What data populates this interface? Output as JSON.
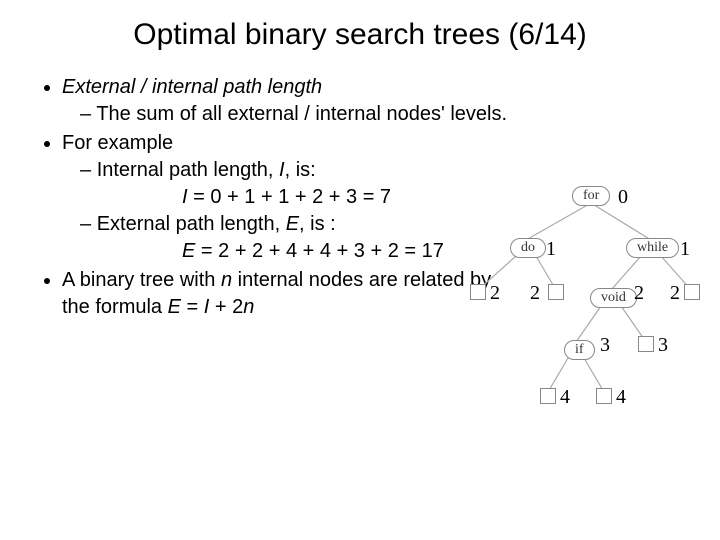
{
  "title": "Optimal binary search trees (6/14)",
  "bullets": {
    "b1": "External / internal path length",
    "b1s1": "The sum of all external / internal nodes' levels.",
    "b2": "For example",
    "b2s1_a": "Internal path length, ",
    "b2s1_var": "I",
    "b2s1_b": ", is:",
    "b2f1_a": "I",
    "b2f1_b": " = 0 + 1 + 1 + 2 + 3 = 7",
    "b2s2_a": "External path length, ",
    "b2s2_var": "E",
    "b2s2_b": ", is :",
    "b2f2_a": "E",
    "b2f2_b": " = 2 + 2 + 4 + 4 + 3 + 2 = 17",
    "b3_a": "A binary tree with ",
    "b3_var": "n",
    "b3_b": " internal nodes are related by the formula ",
    "b3_eq_a": "E",
    "b3_eq_mid": " = ",
    "b3_eq_b": "I",
    "b3_eq_c": " + 2",
    "b3_eq_d": "n"
  },
  "tree": {
    "nodes": {
      "for": "for",
      "do": "do",
      "while": "while",
      "void": "void",
      "if": "if"
    },
    "levels": {
      "l0": "0",
      "l1a": "1",
      "l1b": "1",
      "l2a": "2",
      "l2b": "2",
      "l2c": "2",
      "l2d": "2",
      "l3a": "3",
      "l3b": "3",
      "l4a": "4",
      "l4b": "4"
    }
  }
}
